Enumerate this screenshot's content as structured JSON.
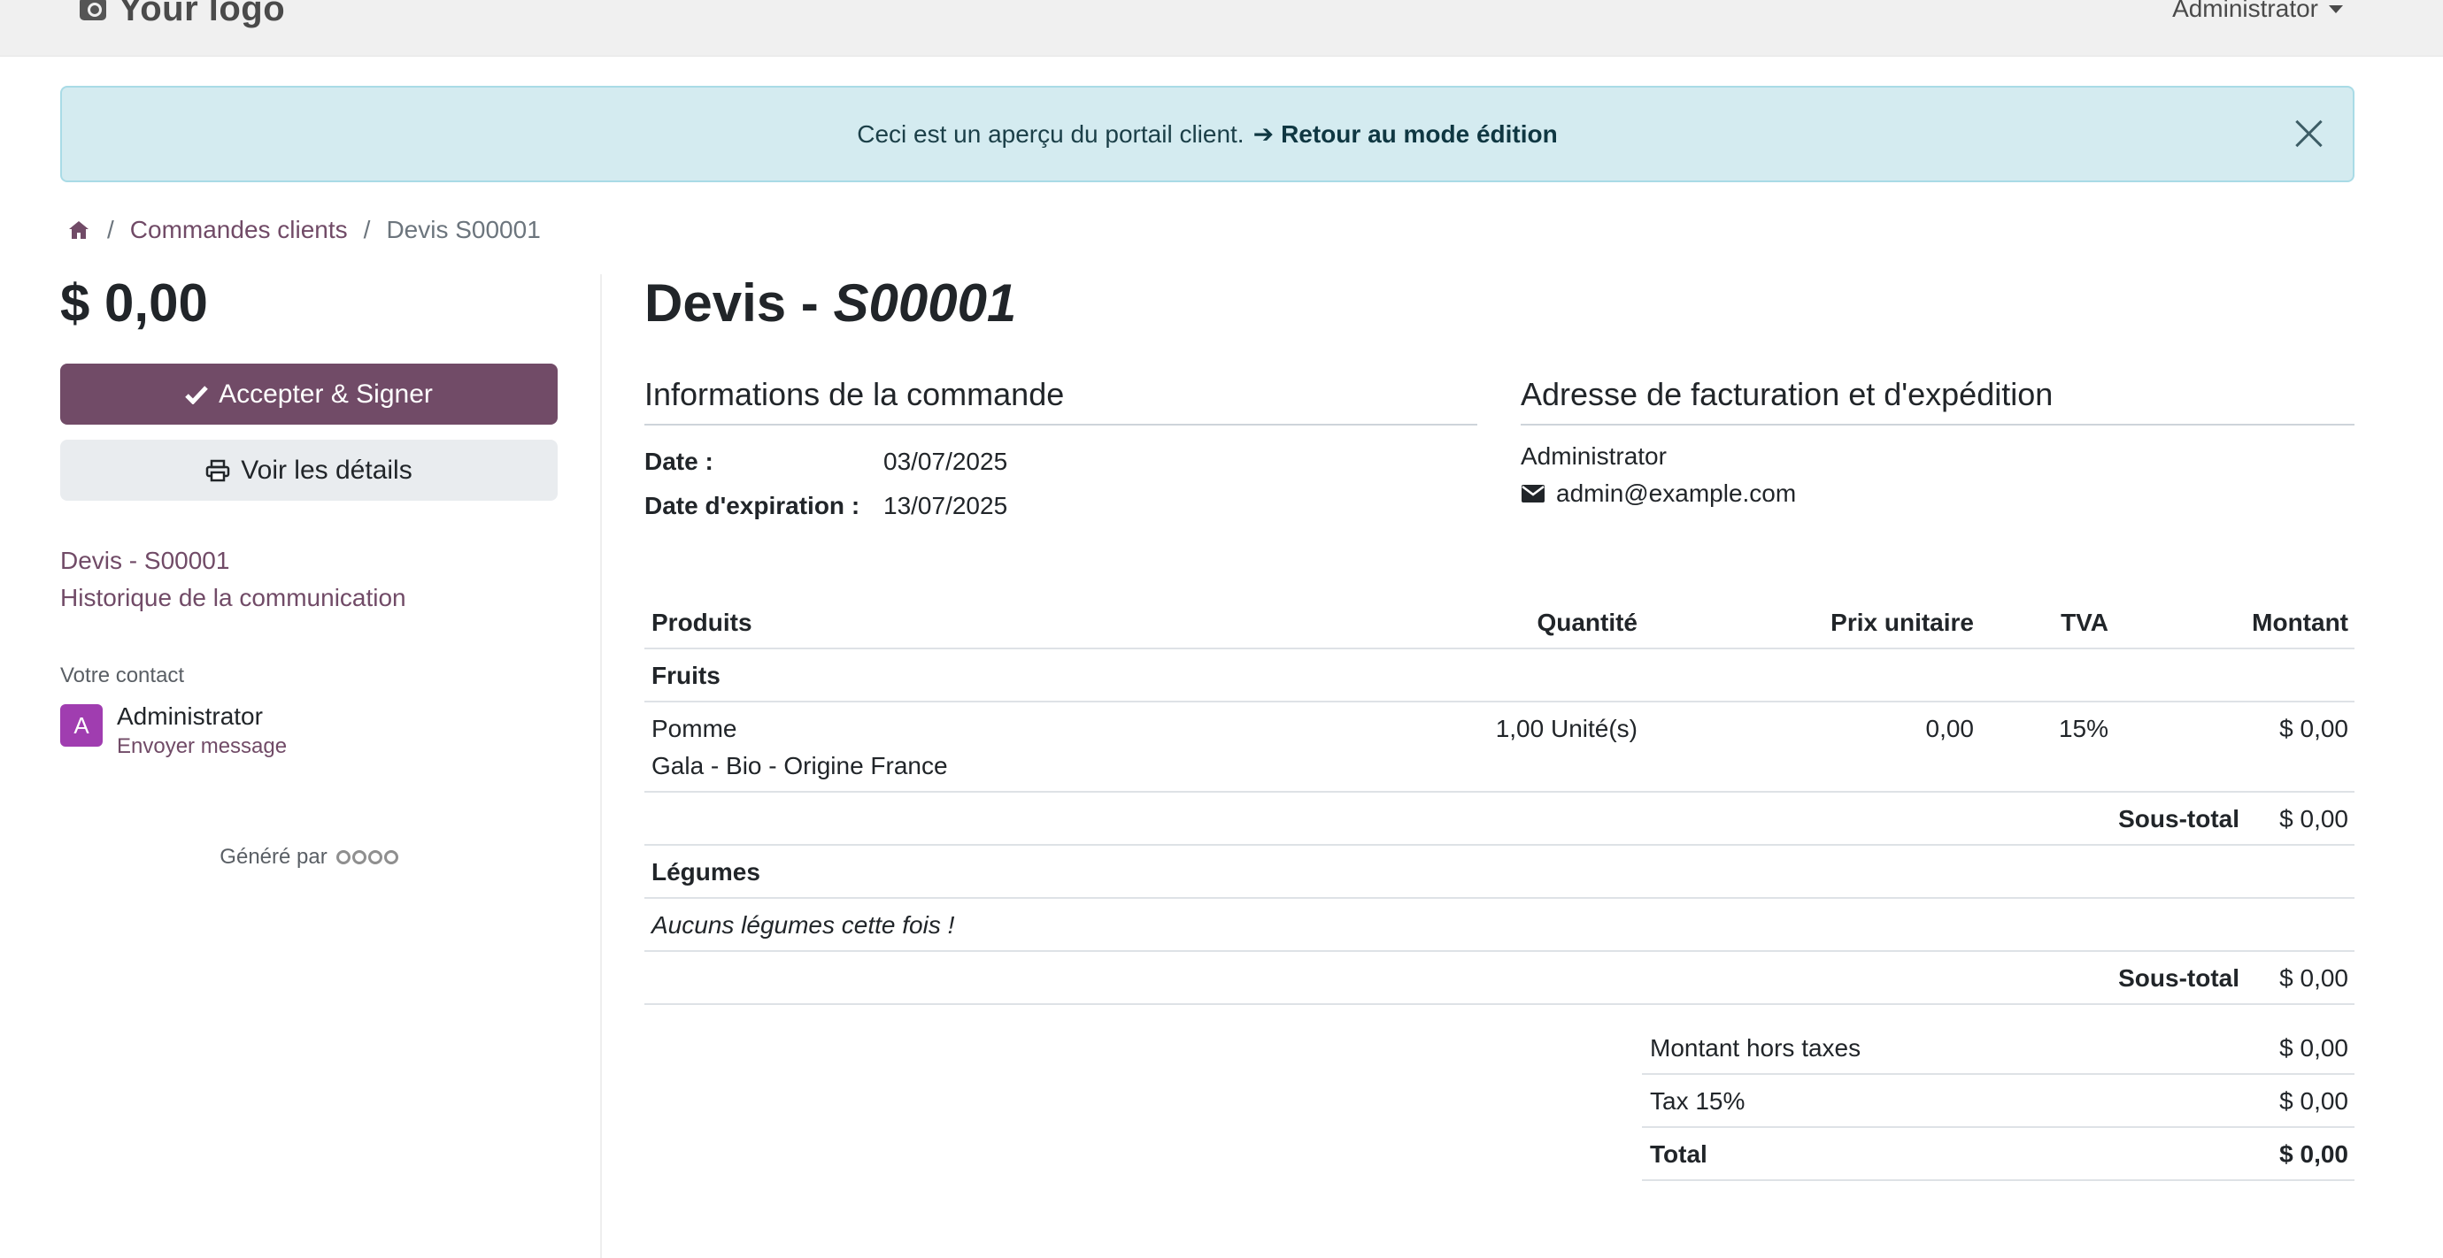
{
  "navbar": {
    "logo_text": "Your logo",
    "user": "Administrator"
  },
  "alert": {
    "text": "Ceci est un aperçu du portail client.",
    "arrow": "➔",
    "link": "Retour au mode édition"
  },
  "breadcrumb": {
    "item1": "Commandes clients",
    "sep": "/",
    "current": "Devis S00001"
  },
  "sidebar": {
    "amount": "$ 0,00",
    "accept_label": "Accepter & Signer",
    "details_label": "Voir les détails",
    "link_quote": "Devis - S00001",
    "link_history": "Historique de la communication",
    "contact_label": "Votre contact",
    "avatar_letter": "A",
    "contact_name": "Administrator",
    "contact_msg": "Envoyer message",
    "generated": "Généré par"
  },
  "main": {
    "title_prefix": "Devis - ",
    "title_number": "S00001",
    "order_info_title": "Informations de la commande",
    "address_title": "Adresse de facturation et d'expédition",
    "date_label": "Date :",
    "date_value": "03/07/2025",
    "expiry_label": "Date d'expiration :",
    "expiry_value": "13/07/2025",
    "addr_name": "Administrator",
    "addr_email": "admin@example.com"
  },
  "table": {
    "headers": {
      "product": "Produits",
      "qty": "Quantité",
      "price": "Prix unitaire",
      "tax": "TVA",
      "amount": "Montant"
    },
    "section1": "Fruits",
    "line1": {
      "name": "Pomme",
      "desc": "Gala - Bio - Origine France",
      "qty": "1,00 Unité(s)",
      "price": "0,00",
      "tax": "15%",
      "amount": "$ 0,00"
    },
    "subtotal_label": "Sous-total",
    "subtotal1": "$ 0,00",
    "section2": "Légumes",
    "note": "Aucuns légumes cette fois !",
    "subtotal2": "$ 0,00"
  },
  "totals": {
    "untaxed_label": "Montant hors taxes",
    "untaxed_value": "$ 0,00",
    "tax_label": "Tax 15%",
    "tax_value": "$ 0,00",
    "total_label": "Total",
    "total_value": "$ 0,00"
  },
  "colors": {
    "brand": "#714b67",
    "alert_bg": "#d4ebf0",
    "avatar": "#a03db0"
  }
}
